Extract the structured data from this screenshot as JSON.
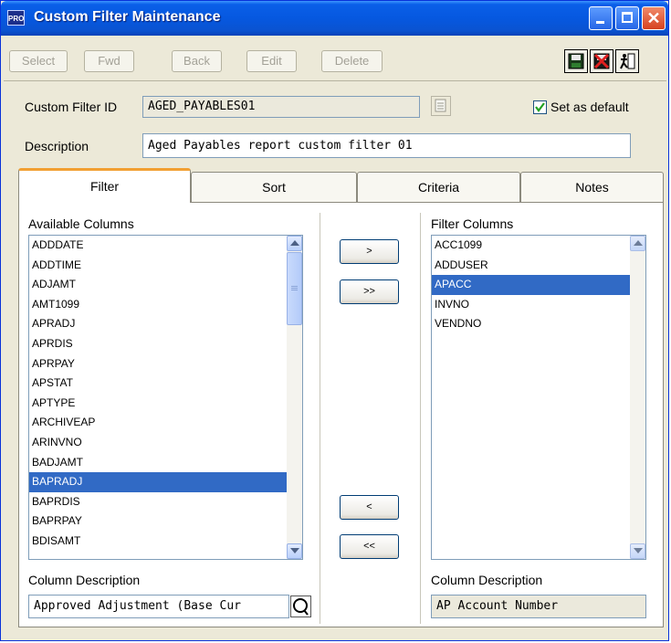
{
  "window": {
    "title": "Custom Filter Maintenance",
    "app_badge": "PRO"
  },
  "toolbar": {
    "select_label": "Select",
    "fwd_label": "Fwd",
    "back_label": "Back",
    "edit_label": "Edit",
    "delete_label": "Delete",
    "icons": [
      "save-icon",
      "cancel-icon",
      "exit-icon"
    ]
  },
  "form": {
    "filter_id_label": "Custom Filter ID",
    "filter_id_value": "AGED_PAYABLES01",
    "set_default_label": "Set as default",
    "set_default_checked": true,
    "description_label": "Description",
    "description_value": "Aged Payables report custom filter 01"
  },
  "tabs": [
    {
      "label": "Filter",
      "active": true
    },
    {
      "label": "Sort",
      "active": false
    },
    {
      "label": "Criteria",
      "active": false
    },
    {
      "label": "Notes",
      "active": false
    }
  ],
  "available": {
    "header": "Available Columns",
    "items": [
      "ADDDATE",
      "ADDTIME",
      "ADJAMT",
      "AMT1099",
      "APRADJ",
      "APRDIS",
      "APRPAY",
      "APSTAT",
      "APTYPE",
      "ARCHIVEAP",
      "ARINVNO",
      "BADJAMT",
      "BAPRADJ",
      "BAPRDIS",
      "BAPRPAY",
      "BDISAMT"
    ],
    "selected": "BAPRADJ",
    "desc_label": "Column Description",
    "desc_value": "Approved Adjustment (Base Cur"
  },
  "move_buttons": {
    "add": ">",
    "add_all": ">>",
    "remove": "<",
    "remove_all": "<<"
  },
  "filter": {
    "header": "Filter Columns",
    "items": [
      "ACC1099",
      "ADDUSER",
      "APACC",
      "INVNO",
      "VENDNO"
    ],
    "selected": "APACC",
    "desc_label": "Column Description",
    "desc_value": "AP Account Number"
  },
  "colors": {
    "title_bar": "#0a5fe8",
    "selection": "#316ac5",
    "tab_accent": "#f2a033",
    "face": "#ece9d8"
  }
}
